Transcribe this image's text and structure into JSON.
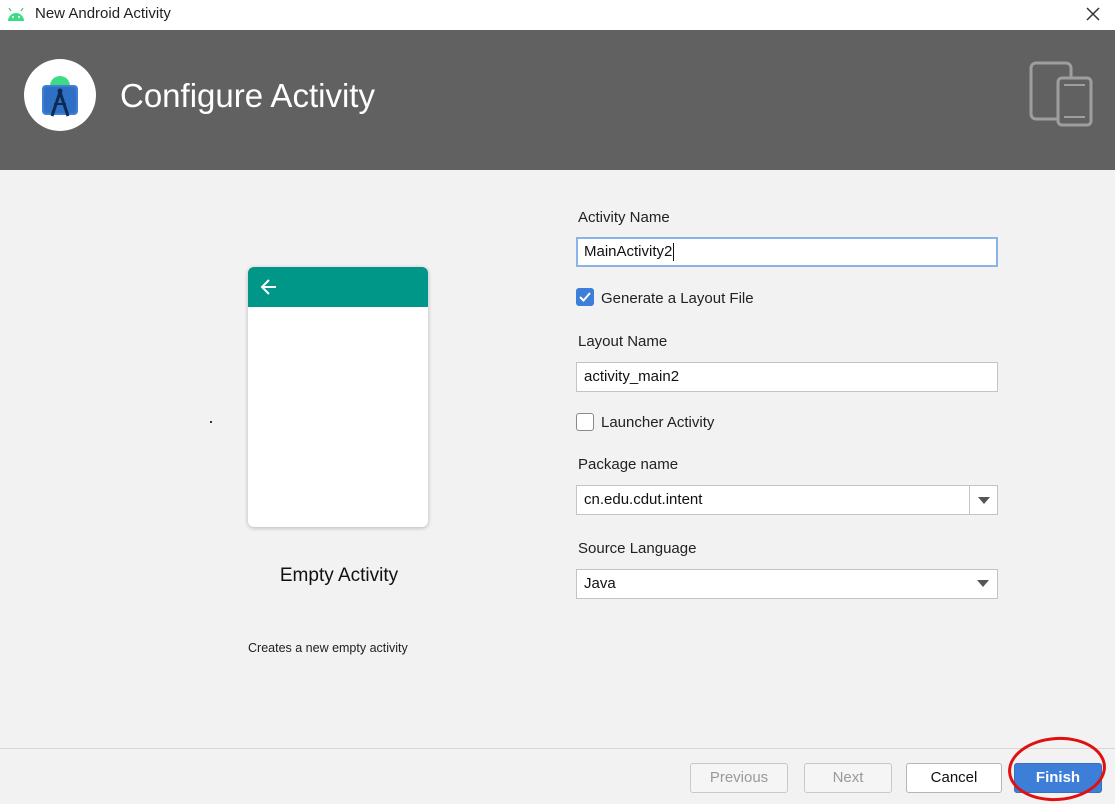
{
  "window": {
    "title": "New Android Activity",
    "close_icon": "close-icon"
  },
  "header": {
    "title": "Configure Activity",
    "logo_icon": "android-studio-logo-icon",
    "devices_icon": "phone-tablet-icon"
  },
  "template": {
    "name": "Empty Activity",
    "description": "Creates a new empty activity",
    "appbar_color": "#009688"
  },
  "form": {
    "activity_name": {
      "label": "Activity Name",
      "value": "MainActivity2"
    },
    "generate_layout": {
      "label": "Generate a Layout File",
      "checked": true
    },
    "layout_name": {
      "label": "Layout Name",
      "value": "activity_main2"
    },
    "launcher_activity": {
      "label": "Launcher Activity",
      "checked": false
    },
    "package_name": {
      "label": "Package name",
      "value": "cn.edu.cdut.intent"
    },
    "source_language": {
      "label": "Source Language",
      "value": "Java"
    }
  },
  "footer": {
    "previous_label": "Previous",
    "next_label": "Next",
    "cancel_label": "Cancel",
    "finish_label": "Finish"
  },
  "colors": {
    "header_bg": "#616161",
    "accent": "#3d7ed8",
    "annotation": "#e01010"
  }
}
